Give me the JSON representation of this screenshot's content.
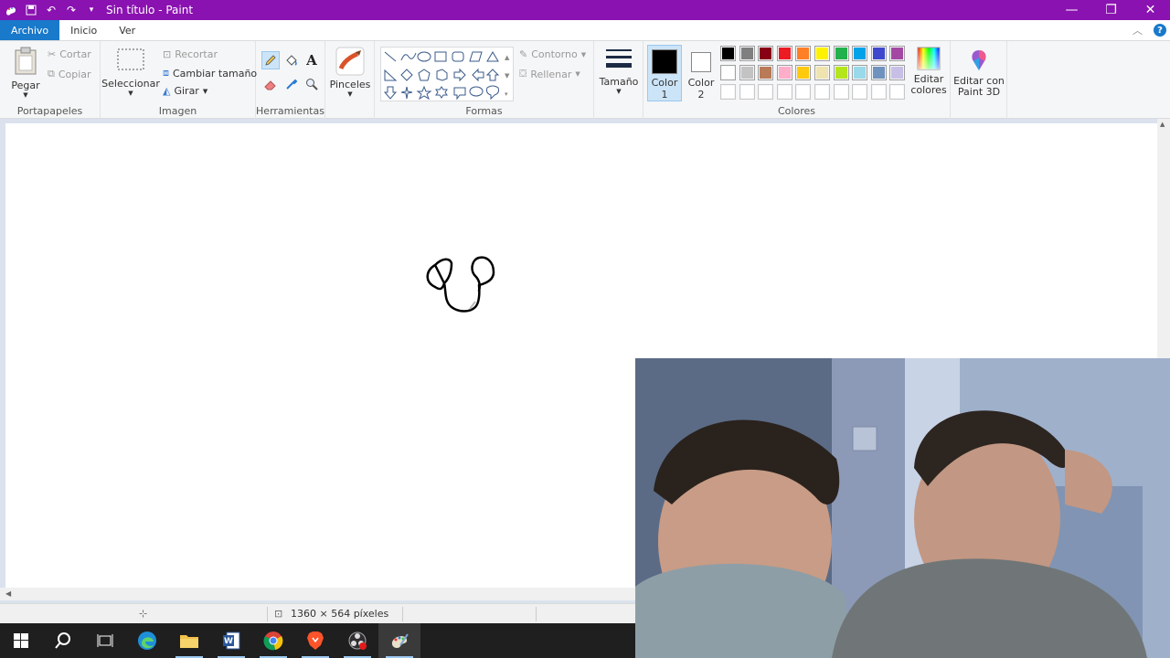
{
  "window": {
    "title": "Sin título - Paint"
  },
  "menu": {
    "file": "Archivo",
    "home": "Inicio",
    "view": "Ver"
  },
  "clipboard": {
    "paste": "Pegar",
    "cut": "Cortar",
    "copy": "Copiar",
    "label": "Portapapeles"
  },
  "image": {
    "select": "Seleccionar",
    "crop": "Recortar",
    "resize": "Cambiar tamaño",
    "rotate": "Girar",
    "label": "Imagen"
  },
  "tools": {
    "label": "Herramientas"
  },
  "brushes": {
    "label": "Pinceles"
  },
  "shapes": {
    "outline": "Contorno",
    "fill": "Rellenar",
    "label": "Formas"
  },
  "size": {
    "label": "Tamaño"
  },
  "colors": {
    "color1": "Color",
    "color1_num": "1",
    "color2": "Color",
    "color2_num": "2",
    "edit": "Editar colores",
    "label": "Colores",
    "color1_value": "#000000",
    "color2_value": "#ffffff",
    "row1": [
      "#000000",
      "#7f7f7f",
      "#880015",
      "#ed1c24",
      "#ff7f27",
      "#fff200",
      "#22b14c",
      "#00a2e8",
      "#3f48cc",
      "#a349a4"
    ],
    "row2": [
      "#ffffff",
      "#c3c3c3",
      "#b97a57",
      "#ffaec9",
      "#ffc90e",
      "#efe4b0",
      "#b5e61d",
      "#99d9ea",
      "#7092be",
      "#c8bfe7"
    ],
    "row3": [
      "#ffffff",
      "#ffffff",
      "#ffffff",
      "#ffffff",
      "#ffffff",
      "#ffffff",
      "#ffffff",
      "#ffffff",
      "#ffffff",
      "#ffffff"
    ]
  },
  "paint3d": {
    "label": "Editar con Paint 3D"
  },
  "status": {
    "dimensions": "1360 × 564 píxeles"
  }
}
